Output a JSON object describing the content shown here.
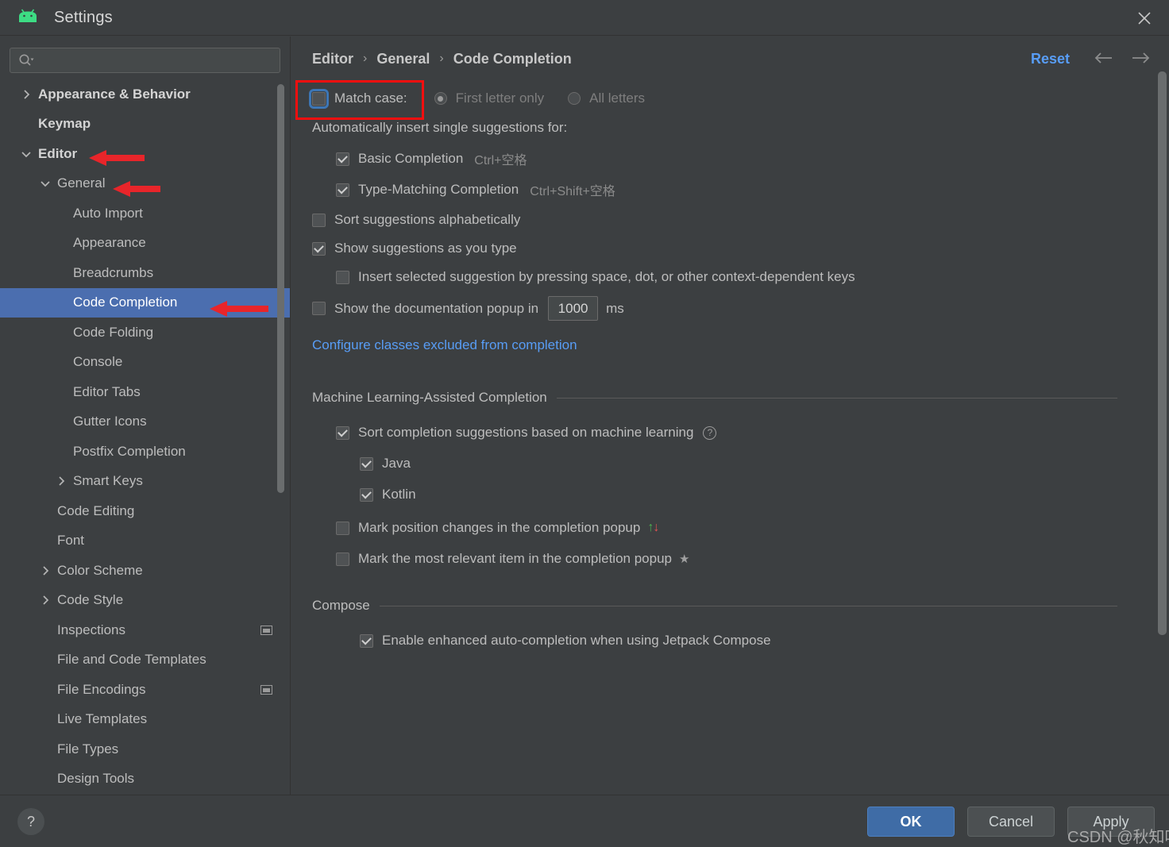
{
  "window": {
    "title": "Settings",
    "logo_icon": "android-logo-icon",
    "close_icon": "close-icon"
  },
  "sidebar": {
    "search": {
      "placeholder": "",
      "value": "",
      "icon": "search-icon"
    },
    "items": [
      {
        "label": "Appearance & Behavior",
        "indent": 0,
        "twisty": "right",
        "bold": true,
        "selected": false,
        "badge": false
      },
      {
        "label": "Keymap",
        "indent": 0,
        "twisty": "none",
        "bold": true,
        "selected": false,
        "badge": false
      },
      {
        "label": "Editor",
        "indent": 0,
        "twisty": "down",
        "bold": true,
        "selected": false,
        "badge": false
      },
      {
        "label": "General",
        "indent": 1,
        "twisty": "down",
        "bold": false,
        "selected": false,
        "badge": false
      },
      {
        "label": "Auto Import",
        "indent": 2,
        "twisty": "none",
        "bold": false,
        "selected": false,
        "badge": false
      },
      {
        "label": "Appearance",
        "indent": 2,
        "twisty": "none",
        "bold": false,
        "selected": false,
        "badge": false
      },
      {
        "label": "Breadcrumbs",
        "indent": 2,
        "twisty": "none",
        "bold": false,
        "selected": false,
        "badge": false
      },
      {
        "label": "Code Completion",
        "indent": 2,
        "twisty": "none",
        "bold": false,
        "selected": true,
        "badge": false
      },
      {
        "label": "Code Folding",
        "indent": 2,
        "twisty": "none",
        "bold": false,
        "selected": false,
        "badge": false
      },
      {
        "label": "Console",
        "indent": 2,
        "twisty": "none",
        "bold": false,
        "selected": false,
        "badge": false
      },
      {
        "label": "Editor Tabs",
        "indent": 2,
        "twisty": "none",
        "bold": false,
        "selected": false,
        "badge": false
      },
      {
        "label": "Gutter Icons",
        "indent": 2,
        "twisty": "none",
        "bold": false,
        "selected": false,
        "badge": false
      },
      {
        "label": "Postfix Completion",
        "indent": 2,
        "twisty": "none",
        "bold": false,
        "selected": false,
        "badge": false
      },
      {
        "label": "Smart Keys",
        "indent": 2,
        "twisty": "right",
        "bold": false,
        "selected": false,
        "badge": false
      },
      {
        "label": "Code Editing",
        "indent": 1,
        "twisty": "none",
        "bold": false,
        "selected": false,
        "badge": false
      },
      {
        "label": "Font",
        "indent": 1,
        "twisty": "none",
        "bold": false,
        "selected": false,
        "badge": false
      },
      {
        "label": "Color Scheme",
        "indent": 1,
        "twisty": "right",
        "bold": false,
        "selected": false,
        "badge": false
      },
      {
        "label": "Code Style",
        "indent": 1,
        "twisty": "right",
        "bold": false,
        "selected": false,
        "badge": false
      },
      {
        "label": "Inspections",
        "indent": 1,
        "twisty": "none",
        "bold": false,
        "selected": false,
        "badge": true
      },
      {
        "label": "File and Code Templates",
        "indent": 1,
        "twisty": "none",
        "bold": false,
        "selected": false,
        "badge": false
      },
      {
        "label": "File Encodings",
        "indent": 1,
        "twisty": "none",
        "bold": false,
        "selected": false,
        "badge": true
      },
      {
        "label": "Live Templates",
        "indent": 1,
        "twisty": "none",
        "bold": false,
        "selected": false,
        "badge": false
      },
      {
        "label": "File Types",
        "indent": 1,
        "twisty": "none",
        "bold": false,
        "selected": false,
        "badge": false
      },
      {
        "label": "Design Tools",
        "indent": 1,
        "twisty": "none",
        "bold": false,
        "selected": false,
        "badge": false
      }
    ]
  },
  "main": {
    "breadcrumb": {
      "first": "Editor",
      "second": "General",
      "third": "Code Completion",
      "separator": "›"
    },
    "reset_label": "Reset",
    "back_icon": "arrow-left-icon",
    "forward_icon": "arrow-right-icon",
    "match_case": {
      "label": "Match case:",
      "checked": false,
      "focused": true,
      "options": [
        {
          "label": "First letter only",
          "selected": true
        },
        {
          "label": "All letters",
          "selected": false
        }
      ]
    },
    "auto_insert_header": "Automatically insert single suggestions for:",
    "auto_insert_items": [
      {
        "label": "Basic Completion",
        "shortcut": "Ctrl+空格",
        "checked": true
      },
      {
        "label": "Type-Matching Completion",
        "shortcut": "Ctrl+Shift+空格",
        "checked": true
      }
    ],
    "sort_alpha": {
      "label": "Sort suggestions alphabetically",
      "checked": false
    },
    "show_as_type": {
      "label": "Show suggestions as you type",
      "checked": true
    },
    "insert_selected": {
      "label": "Insert selected suggestion by pressing space, dot, or other context-dependent keys",
      "checked": false
    },
    "doc_popup": {
      "label_before": "Show the documentation popup in",
      "value": "1000",
      "label_after": "ms",
      "checked": false
    },
    "configure_link": "Configure classes excluded from completion",
    "ml_section": {
      "title": "Machine Learning-Assisted Completion",
      "sort_ml": {
        "label": "Sort completion suggestions based on machine learning",
        "checked": true,
        "help_icon": "help-circle-icon",
        "help_glyph": "?"
      },
      "languages": [
        {
          "label": "Java",
          "checked": true
        },
        {
          "label": "Kotlin",
          "checked": true
        }
      ],
      "mark_position": {
        "label": "Mark position changes in the completion popup",
        "checked": false,
        "icon_up": "↑",
        "icon_down": "↓",
        "color_up": "#4caf50",
        "color_down": "#e05252"
      },
      "mark_relevant": {
        "label": "Mark the most relevant item in the completion popup",
        "checked": false,
        "icon": "★"
      }
    },
    "compose_section": {
      "title": "Compose",
      "enable": {
        "label": "Enable enhanced auto-completion when using Jetpack Compose",
        "checked": true
      }
    }
  },
  "footer": {
    "help_icon": "help-icon",
    "help_glyph": "?",
    "buttons": [
      {
        "label": "OK",
        "primary": true
      },
      {
        "label": "Cancel",
        "primary": false
      },
      {
        "label": "Apply",
        "primary": false
      }
    ]
  },
  "annotations": {
    "watermark": "CSDN @秋知叶i",
    "highlight_color": "#f40f0f",
    "arrows": [
      "arrow-editor",
      "arrow-general",
      "arrow-code-completion"
    ],
    "box": "match-case-highlight-box"
  },
  "colors": {
    "accent_blue": "#589df6",
    "selection_blue": "#4b6eaf",
    "window_bg": "#3c3f41",
    "annotation_red": "#f40f0f"
  }
}
